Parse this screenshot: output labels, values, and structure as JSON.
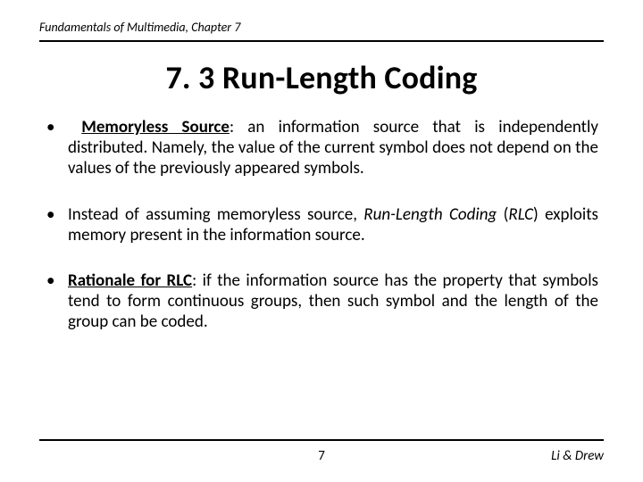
{
  "header": {
    "text": "Fundamentals of Multimedia, Chapter 7"
  },
  "title": "7. 3 Run-Length Coding",
  "bullets": [
    {
      "lead_bold_underlined": "Memoryless Source",
      "after_lead": ": an information source that is independently distributed. Namely, the value of the current symbol does not depend on the values of the previously appeared symbols."
    },
    {
      "pre": "Instead of assuming memoryless source, ",
      "italic1": "Run-Length Coding",
      "mid": " (",
      "italic2": "RLC",
      "post": ") exploits memory present in the information source."
    },
    {
      "lead_bold_underlined": "Rationale for RLC",
      "after_lead": ": if the information source has the property that symbols tend to form continuous groups, then such symbol and the length of the group can be coded."
    }
  ],
  "footer": {
    "page": "7",
    "authors": "Li & Drew"
  }
}
